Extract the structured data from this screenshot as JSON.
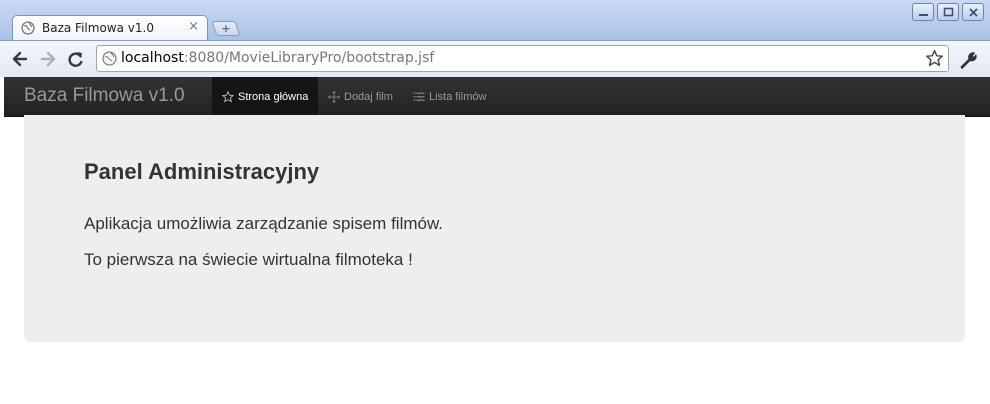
{
  "browser": {
    "tab_title": "Baza Filmowa v1.0",
    "tab_close": "×",
    "new_tab": "+",
    "url_host": "localhost",
    "url_rest": ":8080/MovieLibraryPro/bootstrap.jsf",
    "icons": [
      "globe-icon",
      "back-arrow-icon",
      "forward-arrow-icon",
      "reload-icon",
      "star-icon",
      "wrench-icon",
      "minimize-icon",
      "maximize-icon",
      "close-icon"
    ]
  },
  "navbar": {
    "brand": "Baza Filmowa v1.0",
    "items": [
      {
        "label": "Strona główna",
        "icon": "star-icon",
        "active": true
      },
      {
        "label": "Dodaj film",
        "icon": "move-icon",
        "active": false
      },
      {
        "label": "Lista filmów",
        "icon": "list-icon",
        "active": false
      }
    ]
  },
  "hero": {
    "title": "Panel Administracyjny",
    "line1": "Aplikacja umożliwia zarządzanie spisem filmów.",
    "line2": "To pierwsza na świecie wirtualna filmoteka !"
  },
  "colors": {
    "navbar_bg": "#222222",
    "hero_bg": "#eeeeee",
    "chrome_bg": "#aac2e6"
  }
}
